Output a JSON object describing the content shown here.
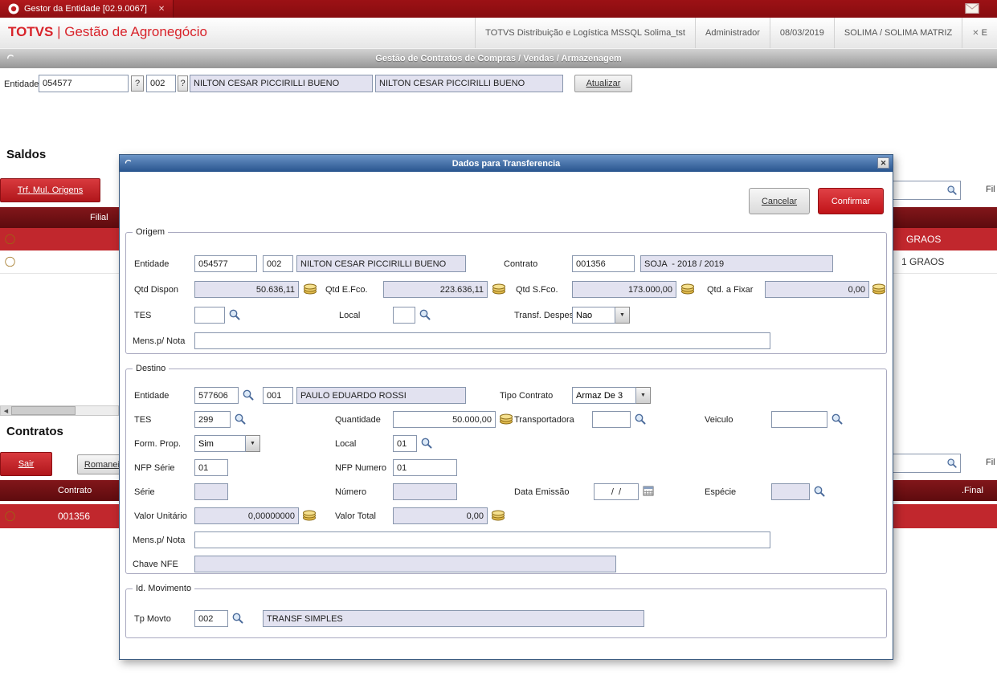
{
  "topbar": {
    "tab_title": "Gestor da Entidade [02.9.0067]"
  },
  "header": {
    "brand_bold": "TOTVS",
    "brand_rest": "| Gestão de Agronegócio",
    "environment": "TOTVS Distribuição e Logística MSSQL Solima_tst",
    "user": "Administrador",
    "date": "08/03/2019",
    "company": "SOLIMA / SOLIMA MATRIZ",
    "close_partial": "E"
  },
  "program_bar": {
    "title": "Gestão de Contratos de Compras / Vendas / Armazenagem"
  },
  "entity_bar": {
    "label": "Entidade",
    "code": "054577",
    "help1": "?",
    "store": "002",
    "help2": "?",
    "name": "NILTON CESAR PICCIRILLI BUENO",
    "name2": "NILTON CESAR PICCIRILLI BUENO",
    "update": "Atualizar"
  },
  "saldos": {
    "title": "Saldos",
    "trf_button": "Trf. Mul. Origens",
    "filter_partial": "Fil",
    "col_filial": "Filial",
    "row1_text": "GRAOS",
    "row2_text": "1 GRAOS"
  },
  "contratos": {
    "title": "Contratos",
    "sair_button": "Sair",
    "romaneio_button": "Romaneio",
    "filter_partial": "Fil",
    "col_contrato": "Contrato",
    "col_final": ".Final",
    "row1_contrato": "001356"
  },
  "modal": {
    "title": "Dados para Transferencia",
    "cancel": "Cancelar",
    "confirm": "Confirmar",
    "origem": {
      "legend": "Origem",
      "entidade_label": "Entidade",
      "entidade": "054577",
      "loja": "002",
      "nome": "NILTON CESAR PICCIRILLI BUENO",
      "contrato_label": "Contrato",
      "contrato": "001356",
      "contrato_desc": "SOJA  - 2018 / 2019",
      "qtd_dispon_label": "Qtd Dispon",
      "qtd_dispon": "50.636,11",
      "qtd_efco_label": "Qtd E.Fco.",
      "qtd_efco": "223.636,11",
      "qtd_sfco_label": "Qtd S.Fco.",
      "qtd_sfco": "173.000,00",
      "qtd_fixar_label": "Qtd. a Fixar",
      "qtd_fixar": "0,00",
      "tes_label": "TES",
      "tes": "",
      "local_label": "Local",
      "local": "",
      "transf_despesa_label": "Transf. Despesa",
      "transf_despesa": "Nao",
      "mens_label": "Mens.p/ Nota",
      "mens": ""
    },
    "destino": {
      "legend": "Destino",
      "entidade_label": "Entidade",
      "entidade": "577606",
      "loja": "001",
      "nome": "PAULO EDUARDO ROSSI",
      "tipo_contrato_label": "Tipo Contrato",
      "tipo_contrato": "Armaz De 3",
      "tes_label": "TES",
      "tes": "299",
      "quantidade_label": "Quantidade",
      "quantidade": "50.000,00",
      "transportadora_label": "Transportadora",
      "transportadora": "",
      "veiculo_label": "Veiculo",
      "veiculo": "",
      "form_prop_label": "Form. Prop.",
      "form_prop": "Sim",
      "local_label": "Local",
      "local": "01",
      "nfp_serie_label": "NFP Série",
      "nfp_serie": "01",
      "nfp_numero_label": "NFP Numero",
      "nfp_numero": "01",
      "serie_label": "Série",
      "serie": "",
      "numero_label": "Número",
      "numero": "",
      "data_emissao_label": "Data Emissão",
      "data_emissao": "/  /",
      "especie_label": "Espécie",
      "especie": "",
      "valor_unitario_label": "Valor Unitário",
      "valor_unitario": "0,00000000",
      "valor_total_label": "Valor Total",
      "valor_total": "0,00",
      "mens_label": "Mens.p/ Nota",
      "mens": "",
      "chave_nfe_label": "Chave NFE",
      "chave_nfe": ""
    },
    "id_movimento": {
      "legend": "Id. Movimento",
      "tp_movto_label": "Tp Movto",
      "tp_movto": "002",
      "tp_movto_desc": "TRANSF SIMPLES"
    }
  },
  "colors": {
    "brand_red": "#d8232a",
    "grid_header_red": "#6b0d10",
    "selected_row_red": "#c1272d",
    "modal_title_blue": "#3a68a5",
    "confirm_red": "#c01318",
    "readonly_bg": "#e2e2f0"
  }
}
